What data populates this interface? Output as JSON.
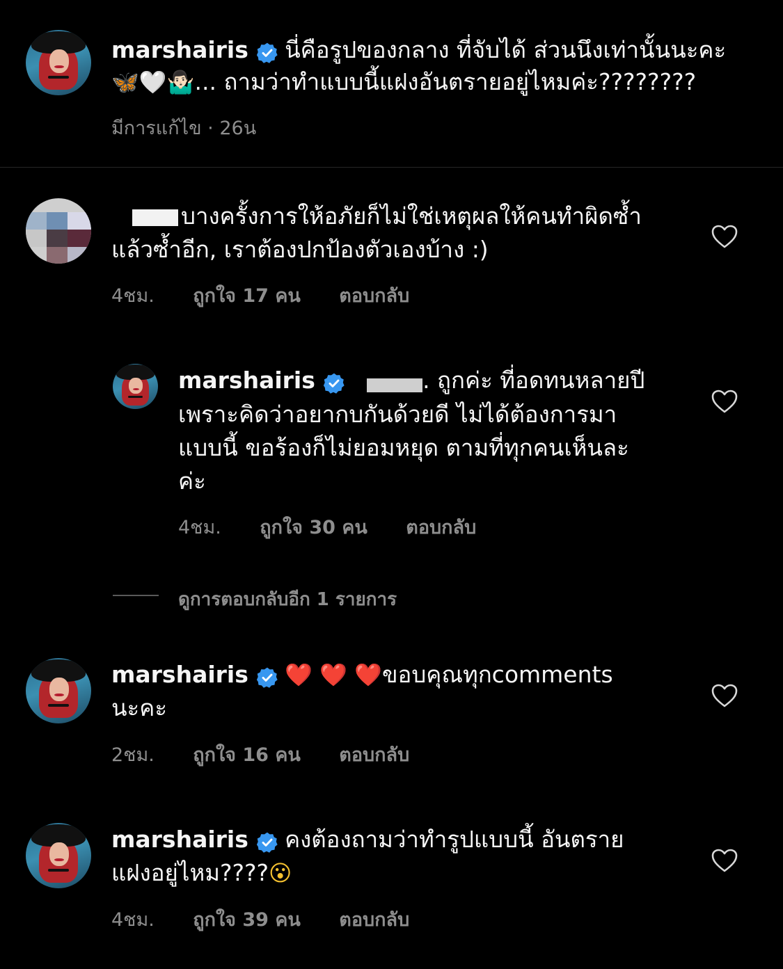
{
  "caption": {
    "username": "marshairis",
    "line1": "นี่คือรูปของกลาง ที่จับได้  ส่วนนึงเท่านั้นนะคะ",
    "line2_emojis": "🦋🤍🤷🏻‍♂️",
    "line2_text": "... ถามว่าทำแบบนี้แฝงอันตรายอยู่ไหมค่ะ????????",
    "meta": "มีการแก้ไข · 26น"
  },
  "comments": [
    {
      "username": "",
      "line1": "บางครั้งการให้อภัยก็ไม่ใช่เหตุผลให้คนทำผิดซ้ำ",
      "line2": "แล้วซ้ำอีก, เราต้องปกป้องตัวเองบ้าง :)",
      "time": "4ชม.",
      "likes": "ถูกใจ 17 คน",
      "reply": "ตอบกลับ"
    },
    {
      "username": "marshairis",
      "line1": ". ถูกค่ะ ที่อดทนหลายปี",
      "line2": "เพราะคิดว่าอยากบกันด้วยดี ไม่ได้ต้องการมา",
      "line3": "แบบนี้ ขอร้องก็ไม่ยอมหยุด ตามที่ทุกคนเห็นละ",
      "line4": "ค่ะ",
      "time": "4ชม.",
      "likes": "ถูกใจ 30 คน",
      "reply": "ตอบกลับ"
    },
    {
      "username": "marshairis",
      "line1_emojis": "❤️ ❤️ ❤️",
      "line1": "ขอบคุณทุกcomments",
      "line2": "นะคะ",
      "time": "2ชม.",
      "likes": "ถูกใจ 16 คน",
      "reply": "ตอบกลับ"
    },
    {
      "username": "marshairis",
      "line1": "คงต้องถามว่าทำรูปแบบนี้ อันตราย",
      "line2": "แฝงอยู่ไหม????",
      "line2_emoji": "😮",
      "time": "4ชม.",
      "likes": "ถูกใจ 39 คน",
      "reply": "ตอบกลับ"
    }
  ],
  "view_replies": "ดูการตอบกลับอีก 1 รายการ",
  "colors": {
    "verified": "#3897f0",
    "meta": "#8e8e8e",
    "background": "#000000"
  }
}
